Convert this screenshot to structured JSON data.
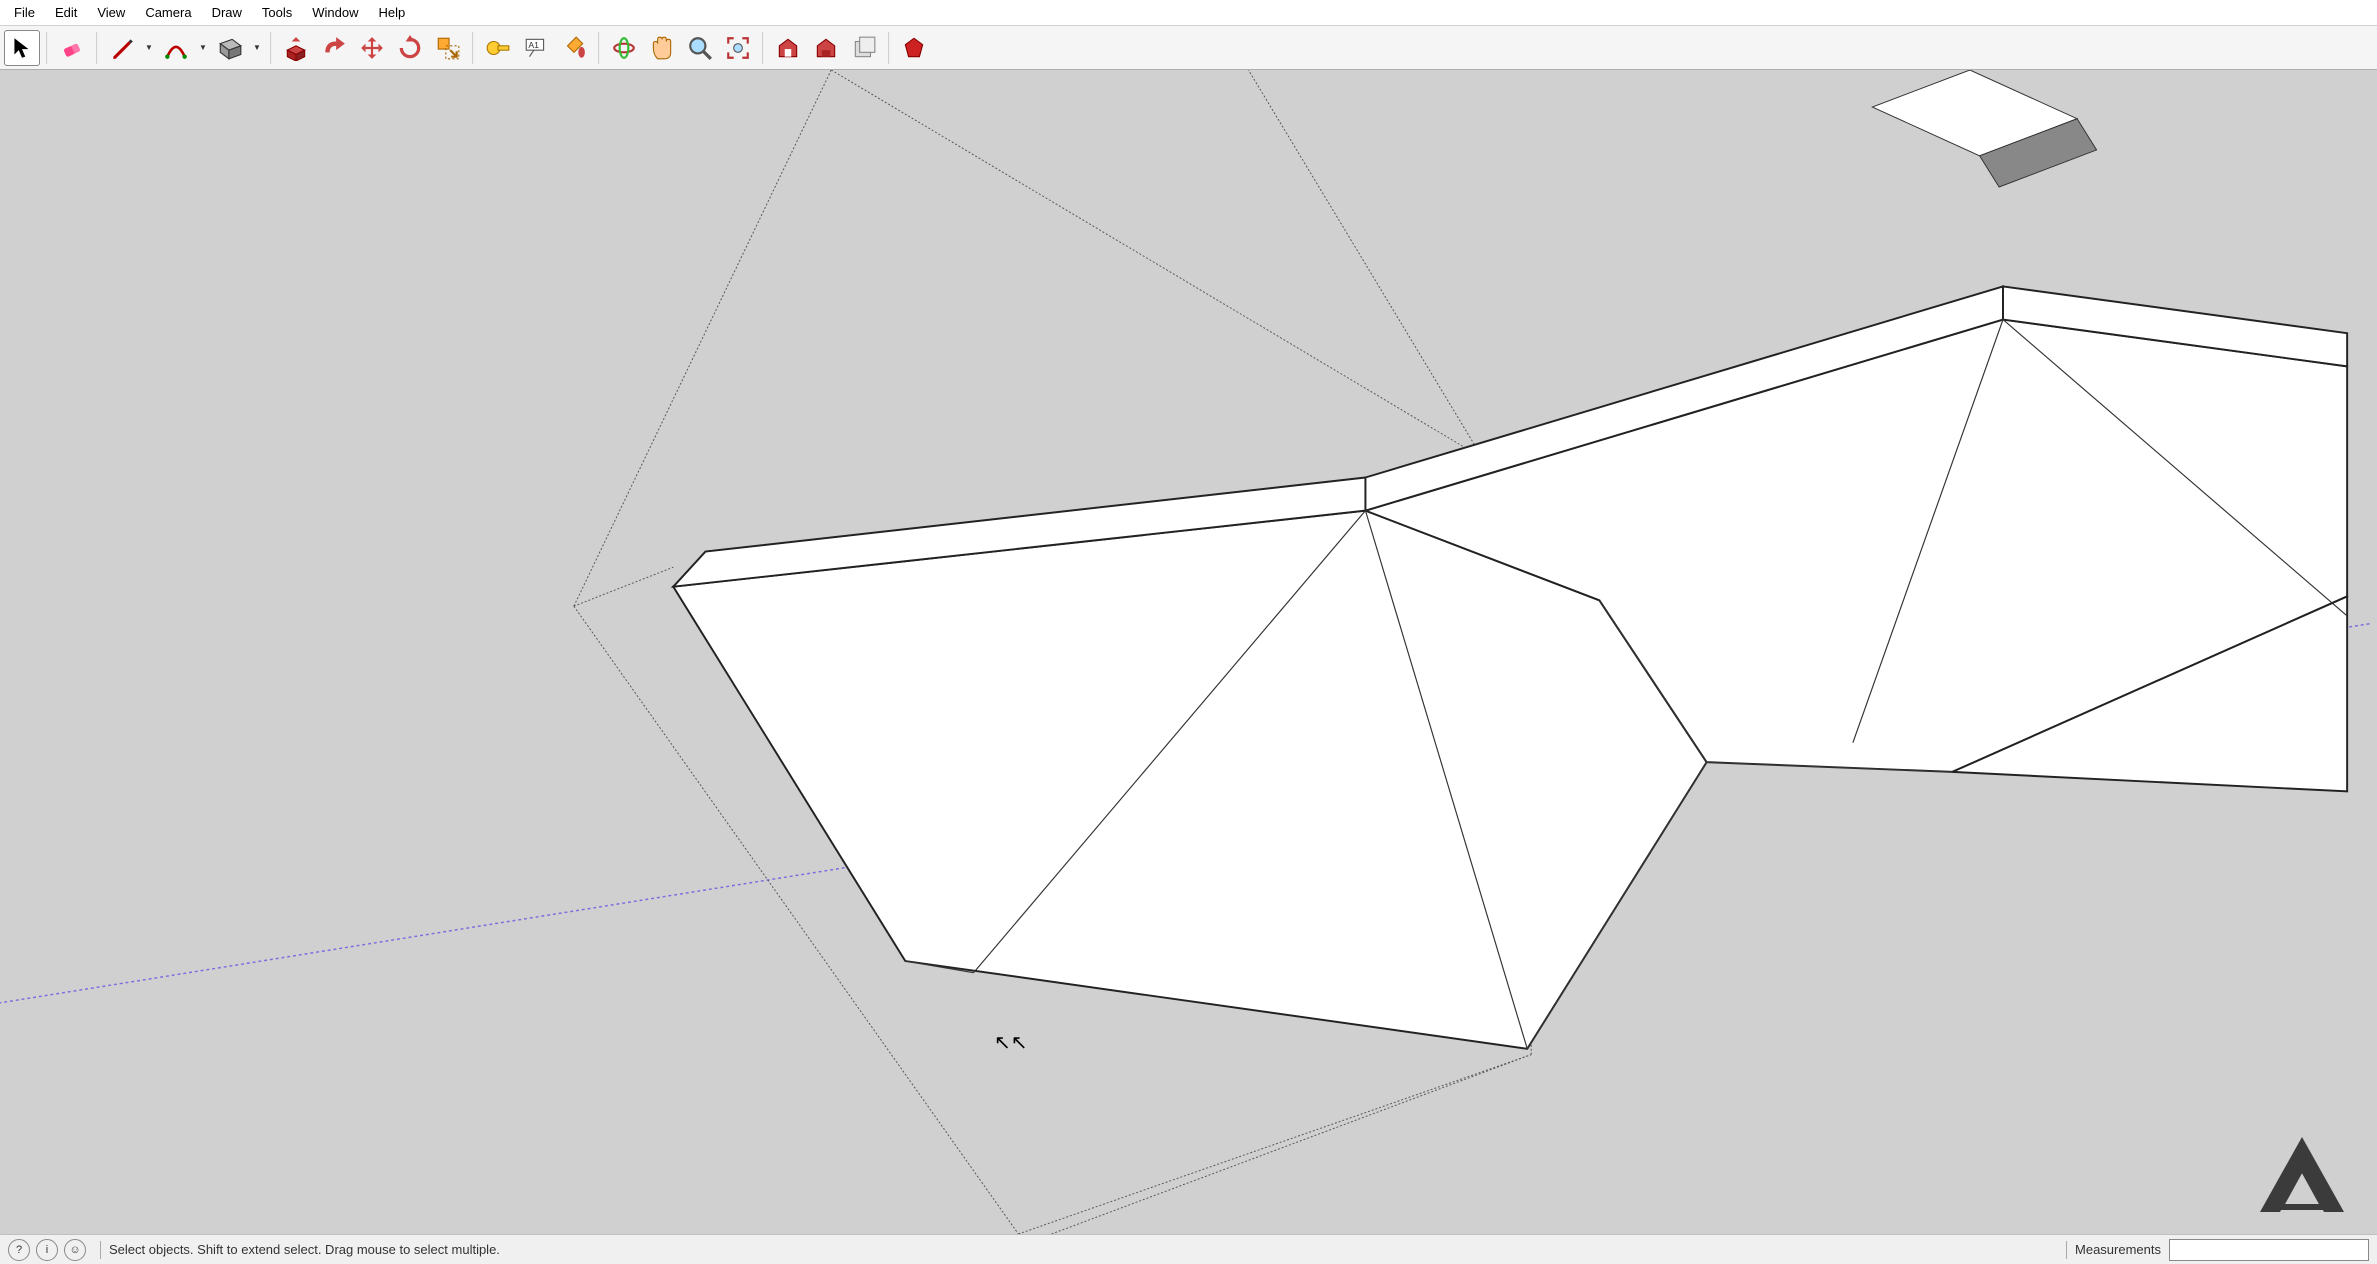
{
  "menu": {
    "items": [
      "File",
      "Edit",
      "View",
      "Camera",
      "Draw",
      "Tools",
      "Window",
      "Help"
    ]
  },
  "toolbar": {
    "tools": [
      {
        "name": "select-tool",
        "active": true
      },
      {
        "name": "eraser-tool"
      },
      {
        "name": "line-tool",
        "dropdown": true
      },
      {
        "name": "arc-tool",
        "dropdown": true
      },
      {
        "name": "rectangle-tool",
        "dropdown": true
      },
      {
        "name": "pushpull-tool"
      },
      {
        "name": "offset-tool"
      },
      {
        "name": "move-tool"
      },
      {
        "name": "rotate-tool"
      },
      {
        "name": "scale-tool"
      },
      {
        "name": "tape-measure-tool"
      },
      {
        "name": "text-tool"
      },
      {
        "name": "paint-bucket-tool"
      },
      {
        "name": "orbit-tool"
      },
      {
        "name": "pan-tool"
      },
      {
        "name": "zoom-tool"
      },
      {
        "name": "zoom-extents-tool"
      },
      {
        "name": "warehouse-tool"
      },
      {
        "name": "extension-warehouse-tool"
      },
      {
        "name": "layers-tool"
      },
      {
        "name": "ruby-tool"
      }
    ]
  },
  "statusbar": {
    "hint": "Select objects. Shift to extend select. Drag mouse to select multiple.",
    "measurements_label": "Measurements",
    "measurements_value": ""
  }
}
